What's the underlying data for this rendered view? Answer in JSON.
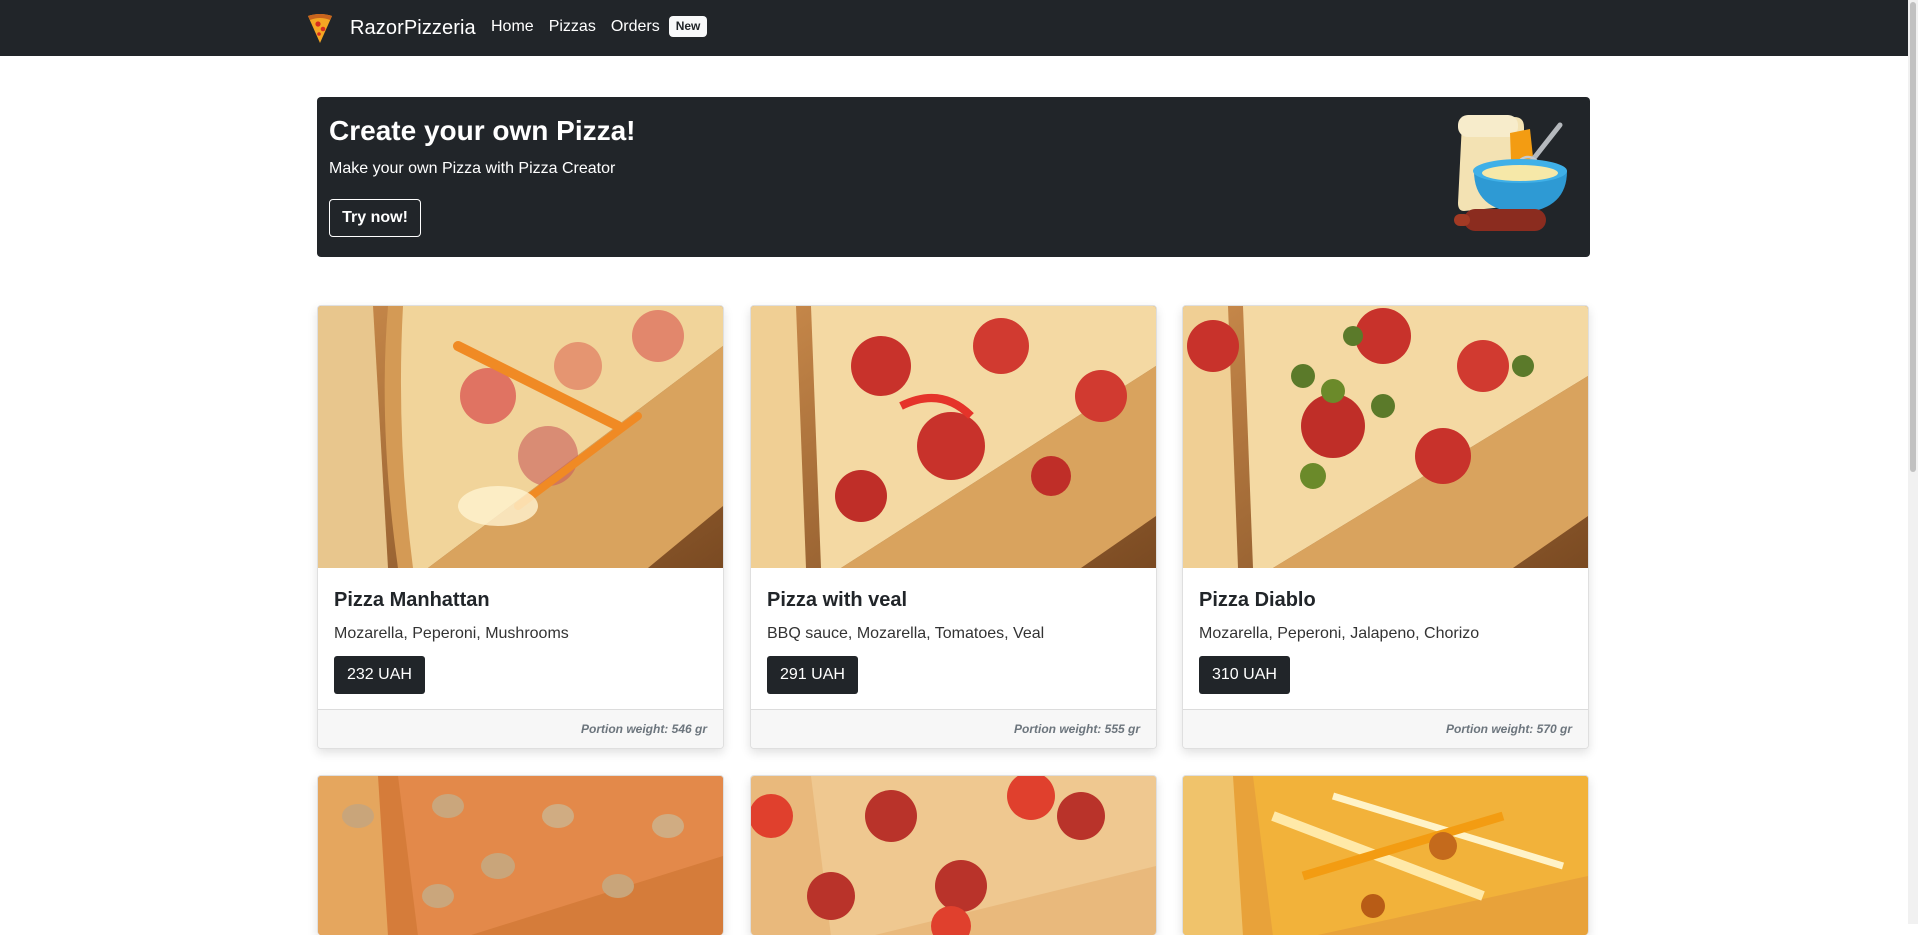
{
  "navbar": {
    "brand": "RazorPizzeria",
    "links": [
      "Home",
      "Pizzas",
      "Orders"
    ],
    "orders_badge": "New"
  },
  "hero": {
    "title": "Create your own Pizza!",
    "subtitle": "Make your own Pizza with Pizza Creator",
    "button_label": "Try now!"
  },
  "pizzas": [
    {
      "name": "Pizza Manhattan",
      "ingredients": "Mozarella, Peperoni, Mushrooms",
      "price": "232 UAH",
      "weight": "Portion weight: 546 gr"
    },
    {
      "name": "Pizza with veal",
      "ingredients": "BBQ sauce, Mozarella, Tomatoes, Veal",
      "price": "291 UAH",
      "weight": "Portion weight: 555 gr"
    },
    {
      "name": "Pizza Diablo",
      "ingredients": "Mozarella, Peperoni, Jalapeno, Chorizo",
      "price": "310 UAH",
      "weight": "Portion weight: 570 gr"
    }
  ],
  "icons": {
    "brand": "pizza-slice-icon",
    "hero_art": "baking-illustration"
  },
  "colors": {
    "dark": "#212529",
    "light": "#f8f9fa",
    "muted": "#6c757d"
  }
}
